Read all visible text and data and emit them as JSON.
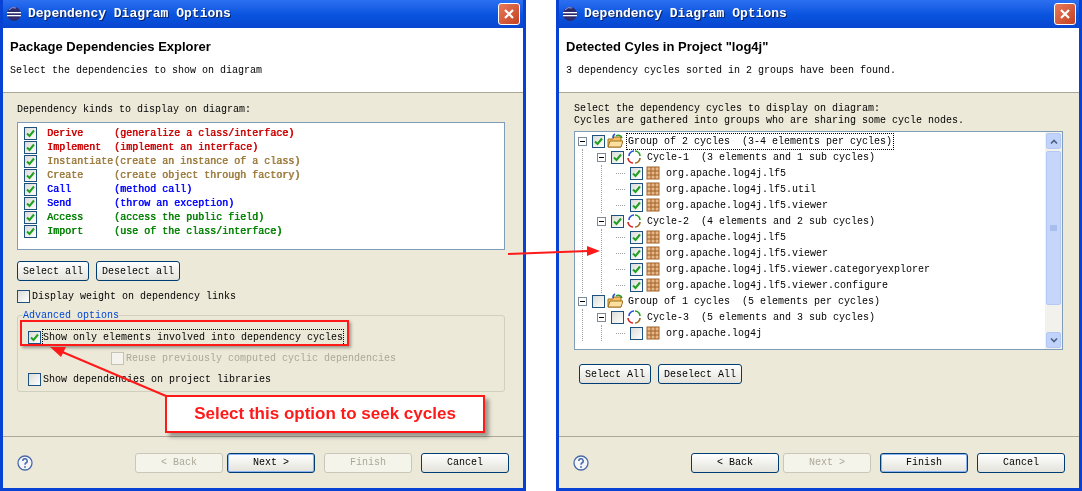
{
  "left_dialog": {
    "title": "Dependency Diagram Options",
    "header": {
      "title": "Package Dependencies Explorer",
      "subtitle": "Select the dependencies to show on diagram"
    },
    "list_label": "Dependency kinds to display on diagram:",
    "dependency_kinds": [
      {
        "name": "Derive",
        "description": "(generalize a class/interface)",
        "color": "#cc0000",
        "checked": true
      },
      {
        "name": "Implement",
        "description": "(implement an interface)",
        "color": "#cc0000",
        "checked": true
      },
      {
        "name": "Instantiate",
        "description": "(create an instance of a class)",
        "color": "#9c7a3c",
        "checked": true
      },
      {
        "name": "Create",
        "description": "(create object through factory)",
        "color": "#9c7a3c",
        "checked": true
      },
      {
        "name": "Call",
        "description": "(method call)",
        "color": "#0000ff",
        "checked": true
      },
      {
        "name": "Send",
        "description": "(throw an exception)",
        "color": "#0000ff",
        "checked": true
      },
      {
        "name": "Access",
        "description": "(access the public field)",
        "color": "#008000",
        "checked": true
      },
      {
        "name": "Import",
        "description": "(use of the class/interface)",
        "color": "#008000",
        "checked": true
      }
    ],
    "list_buttons": [
      "Select all",
      "Deselect all"
    ],
    "display_weight": {
      "label": "Display weight on dependency links",
      "checked": false
    },
    "advanced_options": {
      "label": "Advanced options",
      "options": [
        {
          "kind": "main",
          "label": "Show only elements involved into dependency cycles",
          "checked": true,
          "disabled": false,
          "focused": true
        },
        {
          "kind": "sub",
          "label": "Reuse previously computed cyclic dependencies",
          "checked": false,
          "disabled": true,
          "focused": false
        },
        {
          "kind": "main",
          "label": "Show dependencies on project libraries",
          "checked": false,
          "disabled": false,
          "focused": false
        }
      ]
    },
    "footer_buttons": [
      {
        "label": "< Back",
        "disabled": true,
        "default": false
      },
      {
        "label": "Next >",
        "disabled": false,
        "default": true
      },
      {
        "label": "Finish",
        "disabled": true,
        "default": false
      },
      {
        "label": "Cancel",
        "disabled": false,
        "default": false
      }
    ]
  },
  "right_dialog": {
    "title": "Dependency Diagram Options",
    "header": {
      "title": "Detected Cyles in Project \"log4j\"",
      "subtitle": "3 dependency cycles sorted in 2 groups have been found."
    },
    "instructions": [
      "Select the dependency cycles to display on diagram:",
      "Cycles are gathered into groups who are sharing some cycle nodes."
    ],
    "tree": [
      {
        "kind": "group",
        "label": "Group of 2 cycles  (3-4 elements per cycles)",
        "checked": true,
        "expanded": true,
        "focused": true,
        "children": [
          {
            "kind": "cycle",
            "label": "Cycle-1  (3 elements and 1 sub cycles)",
            "checked": true,
            "expanded": true,
            "children": [
              {
                "kind": "package",
                "label": "org.apache.log4j.lf5",
                "checked": true
              },
              {
                "kind": "package",
                "label": "org.apache.log4j.lf5.util",
                "checked": true
              },
              {
                "kind": "package",
                "label": "org.apache.log4j.lf5.viewer",
                "checked": true
              }
            ]
          },
          {
            "kind": "cycle",
            "label": "Cycle-2  (4 elements and 2 sub cycles)",
            "checked": true,
            "expanded": true,
            "children": [
              {
                "kind": "package",
                "label": "org.apache.log4j.lf5",
                "checked": true
              },
              {
                "kind": "package",
                "label": "org.apache.log4j.lf5.viewer",
                "checked": true
              },
              {
                "kind": "package",
                "label": "org.apache.log4j.lf5.viewer.categoryexplorer",
                "checked": true
              },
              {
                "kind": "package",
                "label": "org.apache.log4j.lf5.viewer.configure",
                "checked": true
              }
            ]
          }
        ]
      },
      {
        "kind": "group",
        "label": "Group of 1 cycles  (5 elements per cycles)",
        "checked": false,
        "expanded": true,
        "focused": false,
        "children": [
          {
            "kind": "cycle",
            "label": "Cycle-3  (5 elements and 3 sub cycles)",
            "checked": false,
            "expanded": true,
            "children": [
              {
                "kind": "package",
                "label": "org.apache.log4j",
                "checked": false
              }
            ]
          }
        ]
      }
    ],
    "list_buttons": [
      "Select All",
      "Deselect All"
    ],
    "footer_buttons": [
      {
        "label": "< Back",
        "disabled": false,
        "default": false
      },
      {
        "label": "Next >",
        "disabled": true,
        "default": false
      },
      {
        "label": "Finish",
        "disabled": false,
        "default": true
      },
      {
        "label": "Cancel",
        "disabled": false,
        "default": false
      }
    ]
  },
  "annotation": {
    "callout": "Select this option to seek cycles"
  }
}
